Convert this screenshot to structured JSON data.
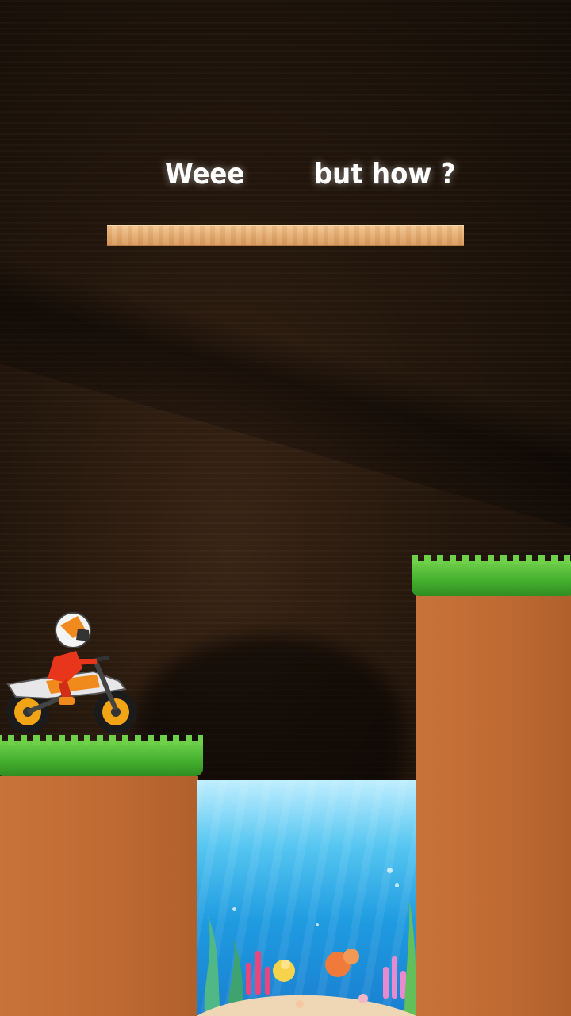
{
  "scene": {
    "label_left": "Weee",
    "label_right": "but how ?"
  },
  "colors": {
    "background": "#1e140b",
    "grass": "#45b02f",
    "dirt": "#c06a33",
    "water": "#1f9be0",
    "plank": "#e5ad72",
    "rider_suit": "#e8361c"
  }
}
